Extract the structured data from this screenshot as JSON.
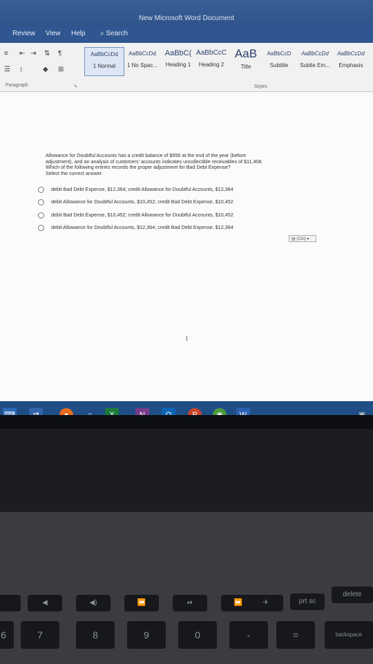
{
  "window": {
    "title": "New Microsoft Word Document"
  },
  "ribbon_tabs": [
    "Review",
    "View",
    "Help",
    "Search"
  ],
  "paragraph_group_label": "Paragraph",
  "styles_group_label": "Styles",
  "styles": [
    {
      "preview": "AaBbCcDd",
      "name": "1 Normal"
    },
    {
      "preview": "AaBbCcDd",
      "name": "1 No Spac..."
    },
    {
      "preview": "AaBbC(",
      "name": "Heading 1"
    },
    {
      "preview": "AaBbCcC",
      "name": "Heading 2"
    },
    {
      "preview": "AaB",
      "name": "Title"
    },
    {
      "preview": "AaBbCcD",
      "name": "Subtitle"
    },
    {
      "preview": "AaBbCcDd",
      "name": "Subtle Em..."
    },
    {
      "preview": "AaBbCcDd",
      "name": "Emphasis"
    }
  ],
  "question": {
    "line1": "Allowance for Doubtful Accounts has a credit balance of $956 at the end of the year (before",
    "line2": "adjustment), and an analysis of customers' accounts indicates uncollectible receivables of $11,408.",
    "line3": "Which of the following entries records the proper adjustment for Bad Debt Expense?",
    "line4": "Select the correct answer."
  },
  "options": [
    "debit Bad Debt Expense, $12,364; credit Allowance for Doubtful Accounts, $12,364",
    "debit Allowance for Doubtful Accounts, $10,452; credit Bad Debt Expense, $10,452",
    "debit Bad Debt Expense, $10,452; credit Allowance for Doubtful Accounts, $10,452",
    "debit Allowance for Doubtful Accounts, $12,364; credit Bad Debt Expense, $12,364"
  ],
  "paste_options": "(Ctrl)",
  "taskbar_letters": {
    "x": "X",
    "n": "N",
    "o": "O",
    "p": "P",
    "w": "W"
  },
  "keys": {
    "prtsc": "prt sc",
    "delete": "delete",
    "backspace": "backspace",
    "k6": "6",
    "k7": "7",
    "k8": "8",
    "k9": "9",
    "k0": "0",
    "kminus": "-",
    "kequals": "="
  }
}
